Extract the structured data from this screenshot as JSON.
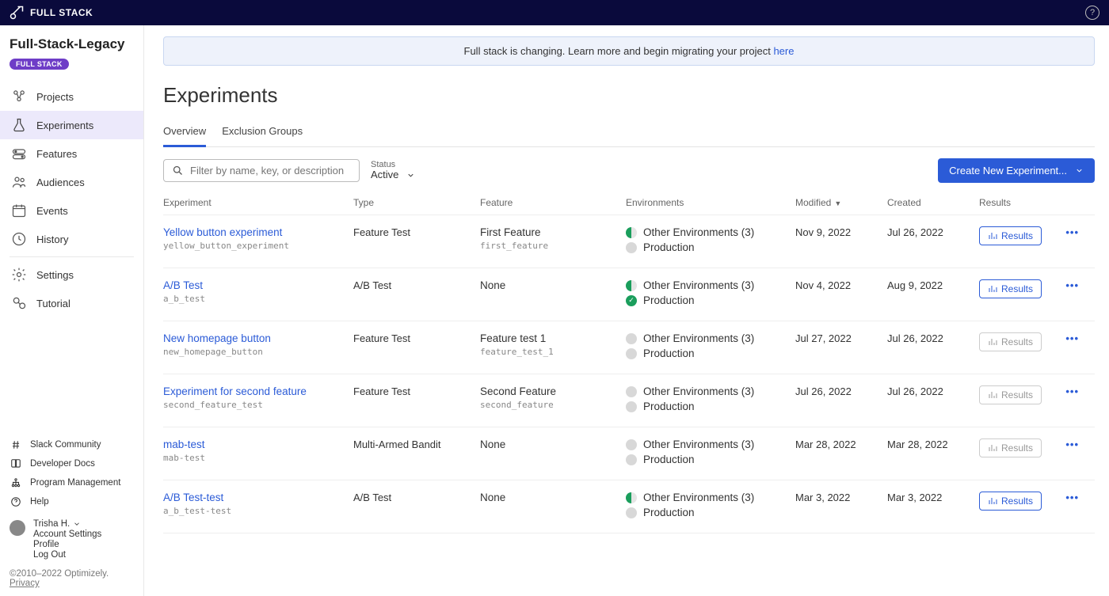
{
  "topbar": {
    "brand": "FULL STACK"
  },
  "sidebar": {
    "project_title": "Full-Stack-Legacy",
    "project_badge": "FULL STACK",
    "nav": [
      {
        "label": "Projects"
      },
      {
        "label": "Experiments"
      },
      {
        "label": "Features"
      },
      {
        "label": "Audiences"
      },
      {
        "label": "Events"
      },
      {
        "label": "History"
      },
      {
        "label": "Settings"
      },
      {
        "label": "Tutorial"
      }
    ],
    "footer_links": [
      {
        "label": "Slack Community"
      },
      {
        "label": "Developer Docs"
      },
      {
        "label": "Program Management"
      },
      {
        "label": "Help"
      }
    ],
    "user": {
      "name": "Trisha H.",
      "links": [
        "Account Settings",
        "Profile",
        "Log Out"
      ]
    },
    "copyright_text": "©2010–2022 Optimizely. ",
    "privacy_label": "Privacy"
  },
  "banner": {
    "text": "Full stack is changing. Learn more and begin migrating your project ",
    "link_label": "here"
  },
  "page": {
    "title": "Experiments",
    "tabs": [
      "Overview",
      "Exclusion Groups"
    ],
    "search_placeholder": "Filter by name, key, or description",
    "status_label": "Status",
    "status_value": "Active",
    "create_button": "Create New Experiment..."
  },
  "table": {
    "headers": {
      "experiment": "Experiment",
      "type": "Type",
      "feature": "Feature",
      "environments": "Environments",
      "modified": "Modified",
      "created": "Created",
      "results": "Results"
    },
    "results_button_label": "Results",
    "rows": [
      {
        "name": "Yellow button experiment",
        "key": "yellow_button_experiment",
        "type": "Feature Test",
        "feature_name": "First Feature",
        "feature_key": "first_feature",
        "env1_state": "half",
        "env1_label": "Other Environments (3)",
        "env2_state": "gray",
        "env2_label": "Production",
        "modified": "Nov 9, 2022",
        "created": "Jul 26, 2022",
        "results_enabled": true
      },
      {
        "name": "A/B Test",
        "key": "a_b_test",
        "type": "A/B Test",
        "feature_name": "None",
        "feature_key": "",
        "env1_state": "half",
        "env1_label": "Other Environments (3)",
        "env2_state": "green",
        "env2_label": "Production",
        "modified": "Nov 4, 2022",
        "created": "Aug 9, 2022",
        "results_enabled": true
      },
      {
        "name": "New homepage button",
        "key": "new_homepage_button",
        "type": "Feature Test",
        "feature_name": "Feature test 1",
        "feature_key": "feature_test_1",
        "env1_state": "gray",
        "env1_label": "Other Environments (3)",
        "env2_state": "gray",
        "env2_label": "Production",
        "modified": "Jul 27, 2022",
        "created": "Jul 26, 2022",
        "results_enabled": false
      },
      {
        "name": "Experiment for second feature",
        "key": "second_feature_test",
        "type": "Feature Test",
        "feature_name": "Second Feature",
        "feature_key": "second_feature",
        "env1_state": "gray",
        "env1_label": "Other Environments (3)",
        "env2_state": "gray",
        "env2_label": "Production",
        "modified": "Jul 26, 2022",
        "created": "Jul 26, 2022",
        "results_enabled": false
      },
      {
        "name": "mab-test",
        "key": "mab-test",
        "type": "Multi-Armed Bandit",
        "feature_name": "None",
        "feature_key": "",
        "env1_state": "gray",
        "env1_label": "Other Environments (3)",
        "env2_state": "gray",
        "env2_label": "Production",
        "modified": "Mar 28, 2022",
        "created": "Mar 28, 2022",
        "results_enabled": false
      },
      {
        "name": "A/B Test-test",
        "key": "a_b_test-test",
        "type": "A/B Test",
        "feature_name": "None",
        "feature_key": "",
        "env1_state": "half",
        "env1_label": "Other Environments (3)",
        "env2_state": "gray",
        "env2_label": "Production",
        "modified": "Mar 3, 2022",
        "created": "Mar 3, 2022",
        "results_enabled": true
      }
    ]
  }
}
